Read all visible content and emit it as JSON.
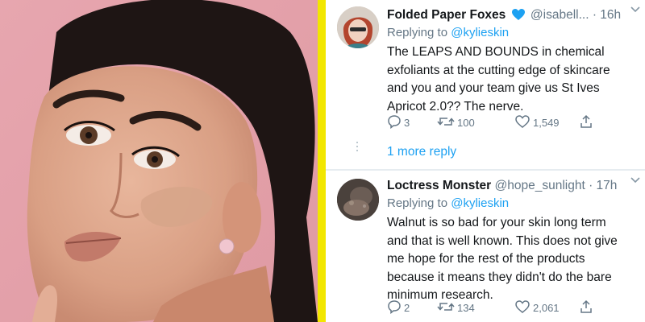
{
  "tweets": [
    {
      "display_name": "Folded Paper Foxes",
      "handle": "@isabell...",
      "time": "· 16h",
      "reply_label": "Replying to",
      "reply_user": "@kylieskin",
      "body": "The LEAPS AND BOUNDS in chemical exfoliants at the cutting edge of skincare and you and your team give us St Ives Apricot 2.0?? The nerve.",
      "replies": "3",
      "retweets": "100",
      "likes": "1,549",
      "more_replies": "1 more reply"
    },
    {
      "display_name": "Loctress Monster",
      "handle": "@hope_sunlight",
      "time": "· 17h",
      "reply_label": "Replying to",
      "reply_user": "@kylieskin",
      "body": "Walnut is so bad for your skin long term and that is well known. This does not give me hope for the rest of the products because it means they didn't do the bare minimum research.",
      "replies": "2",
      "retweets": "134",
      "likes": "2,061"
    }
  ],
  "colors": {
    "divider": "#f2e600",
    "link": "#1da1f2",
    "verified": "#1da1f2",
    "photo_bg": "#e4a4ac"
  },
  "icons": [
    "reply-icon",
    "retweet-icon",
    "like-icon",
    "share-icon",
    "chevron-down-icon",
    "verified-heart-icon"
  ]
}
